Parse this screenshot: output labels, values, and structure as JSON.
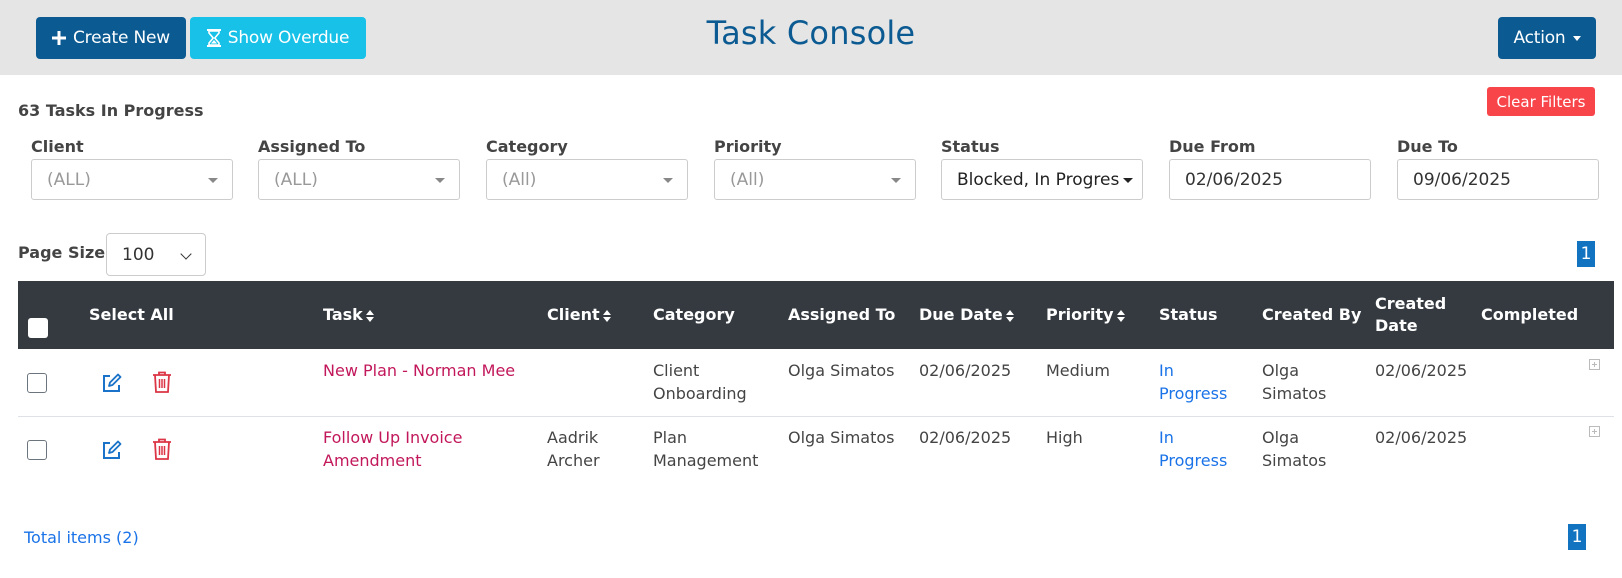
{
  "header": {
    "create_label": "Create New",
    "overdue_label": "Show Overdue",
    "title": "Task Console",
    "action_label": "Action"
  },
  "summary": "63 Tasks In Progress",
  "clear_filters": "Clear Filters",
  "filters": {
    "client": {
      "label": "Client",
      "value": "(ALL)"
    },
    "assigned_to": {
      "label": "Assigned To",
      "value": "(ALL)"
    },
    "category": {
      "label": "Category",
      "value": "(All)"
    },
    "priority": {
      "label": "Priority",
      "value": "(All)"
    },
    "status": {
      "label": "Status",
      "value": "Blocked, In Progres"
    },
    "due_from": {
      "label": "Due From",
      "value": "02/06/2025"
    },
    "due_to": {
      "label": "Due To",
      "value": "09/06/2025"
    }
  },
  "page_size": {
    "label": "Page Size:",
    "value": "100"
  },
  "pager": {
    "top_page": "1",
    "bottom_page": "1"
  },
  "table": {
    "columns": {
      "select_all": "Select All",
      "task": "Task",
      "client": "Client",
      "category": "Category",
      "assigned_to": "Assigned To",
      "due_date": "Due Date",
      "priority": "Priority",
      "status": "Status",
      "created_by": "Created By",
      "created_date": "Created Date",
      "completed": "Completed"
    },
    "rows": [
      {
        "task": "New Plan - Norman Mee",
        "client": "",
        "category": "Client Onboarding",
        "assigned_to": "Olga Simatos",
        "due_date": "02/06/2025",
        "priority": "Medium",
        "status": "In Progress",
        "created_by": "Olga Simatos",
        "created_date": "02/06/2025",
        "completed": ""
      },
      {
        "task": "Follow Up Invoice Amendment",
        "client": "Aadrik Archer",
        "category": "Plan Management",
        "assigned_to": "Olga Simatos",
        "due_date": "02/06/2025",
        "priority": "High",
        "status": "In Progress",
        "created_by": "Olga Simatos",
        "created_date": "02/06/2025",
        "completed": ""
      }
    ]
  },
  "footer": {
    "total_items": "Total items (2)"
  },
  "colors": {
    "primary": "#0b5a92",
    "info": "#17c1e8",
    "danger": "#f8454a",
    "header_dark": "#343a40",
    "task_link": "#c2185b",
    "status_link": "#1a73e8",
    "edit_icon": "#1a73c8",
    "trash_icon": "#dc3545"
  },
  "icons": [
    "plus-icon",
    "hourglass-icon",
    "caret-down-icon",
    "sort-icon",
    "edit-icon",
    "trash-icon",
    "expand-icon"
  ]
}
